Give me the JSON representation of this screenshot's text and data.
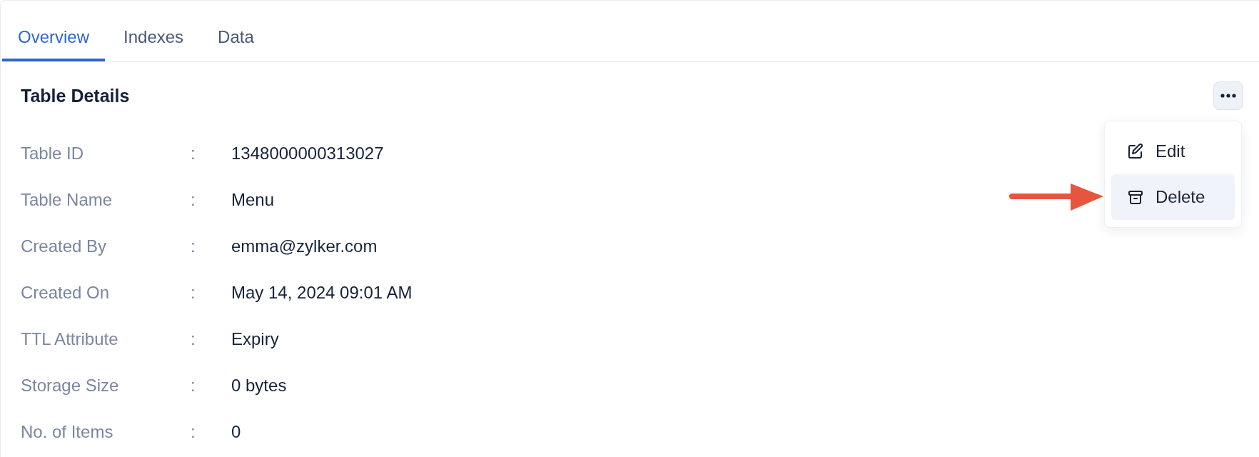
{
  "tabs": [
    {
      "label": "Overview",
      "selected": true
    },
    {
      "label": "Indexes",
      "selected": false
    },
    {
      "label": "Data",
      "selected": false
    }
  ],
  "panel": {
    "title": "Table Details"
  },
  "menu": {
    "expanded": true,
    "items": [
      {
        "kind": "edit",
        "label": "Edit",
        "selected": false
      },
      {
        "kind": "delete",
        "label": "Delete",
        "selected": true
      }
    ]
  },
  "details": [
    {
      "label": "Table ID",
      "separator": ":",
      "value": "1348000000313027"
    },
    {
      "label": "Table Name",
      "separator": ":",
      "value": "Menu"
    },
    {
      "label": "Created By",
      "separator": ":",
      "value": "emma@zylker.com"
    },
    {
      "label": "Created On",
      "separator": ":",
      "value": "May 14, 2024 09:01 AM"
    },
    {
      "label": "TTL Attribute",
      "separator": ":",
      "value": "Expiry"
    },
    {
      "label": "Storage Size",
      "separator": ":",
      "value": "0 bytes"
    },
    {
      "label": "No. of Items",
      "separator": ":",
      "value": "0"
    }
  ]
}
